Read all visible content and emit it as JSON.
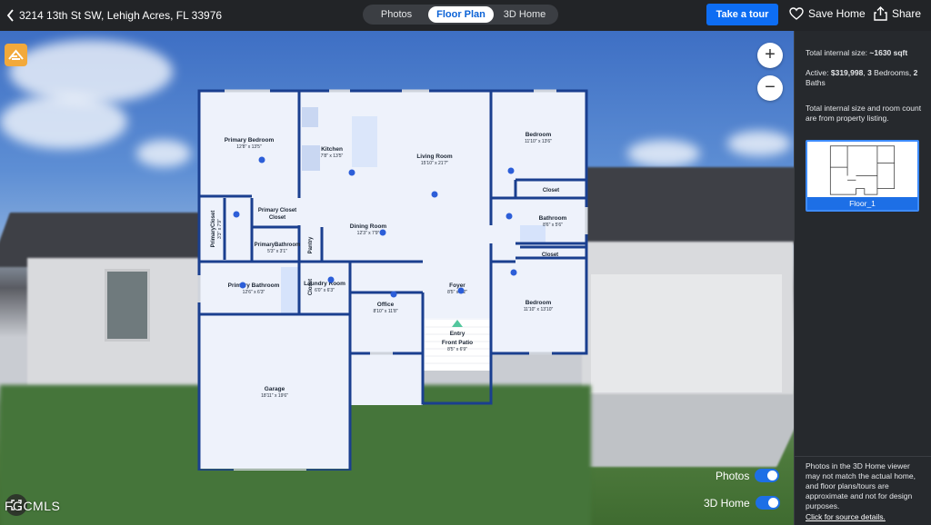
{
  "header": {
    "address": "3214 13th St SW, Lehigh Acres, FL 33976",
    "tabs": [
      {
        "label": "Photos"
      },
      {
        "label": "Floor Plan"
      },
      {
        "label": "3D Home"
      }
    ],
    "tour_button": "Take a tour",
    "save_label": "Save Home",
    "share_label": "Share"
  },
  "viewer": {
    "zoom_in": "+",
    "zoom_out": "−",
    "toggles": {
      "photos_label": "Photos",
      "home3d_label": "3D Home"
    },
    "watermark": "FGCMLS"
  },
  "floorplan": {
    "rooms": [
      {
        "name": "Primary Bedroom",
        "size": "12'8\" x 13'5\""
      },
      {
        "name": "Kitchen",
        "size": "7'8\" x 13'5\""
      },
      {
        "name": "Living Room",
        "size": "15'10\" x 21'7\""
      },
      {
        "name": "Bedroom",
        "size": "11'10\" x 13'6\""
      },
      {
        "name": "Closet",
        "size": ""
      },
      {
        "name": "Bathroom",
        "size": "8'6\" x 5'6\""
      },
      {
        "name": "Closet",
        "size": ""
      },
      {
        "name": "PrimaryCloset",
        "size": "3'3\" x 7'9\""
      },
      {
        "name": "Primary Closet",
        "size": ""
      },
      {
        "name": "Pantry",
        "size": ""
      },
      {
        "name": "Dining Room",
        "size": "12'3\" x 7'9\""
      },
      {
        "name": "PrimaryBathroom",
        "size": "5'3\" x 3'1\""
      },
      {
        "name": "Closet",
        "size": ""
      },
      {
        "name": "Primary Bathroom",
        "size": "12'6\" x 6'3\""
      },
      {
        "name": "Laundry Room",
        "size": "6'0\" x 6'3\""
      },
      {
        "name": "Office",
        "size": "8'10\" x 11'8\""
      },
      {
        "name": "Foyer",
        "size": "8'5\" x 9'2\""
      },
      {
        "name": "Bedroom",
        "size": "11'10\" x 13'10\""
      },
      {
        "name": "Entry",
        "size": ""
      },
      {
        "name": "Front Patio",
        "size": "8'5\" x 6'9\""
      },
      {
        "name": "Garage",
        "size": "18'11\" x 19'6\""
      }
    ]
  },
  "sidebar": {
    "size_prefix": "Total internal size: ",
    "size_value": "~1630 sqft",
    "active_prefix": "Active: ",
    "price": "$319,998",
    "sep1": ", ",
    "beds": "3",
    "beds_label": " Bedrooms, ",
    "baths": "2",
    "baths_label": " Baths",
    "note": "Total internal size and room count are from property listing.",
    "floor_label": "Floor_1",
    "disclaimer": "Photos in the 3D Home viewer may not match the actual home, and floor plans/tours are approximate and not for design purposes.",
    "source_link": "Click for source details."
  },
  "colors": {
    "accent": "#0d6df3",
    "wall": "#1a3f8f",
    "floor": "#eef2fb",
    "topbar": "#222427",
    "sidebar": "#26292d"
  }
}
